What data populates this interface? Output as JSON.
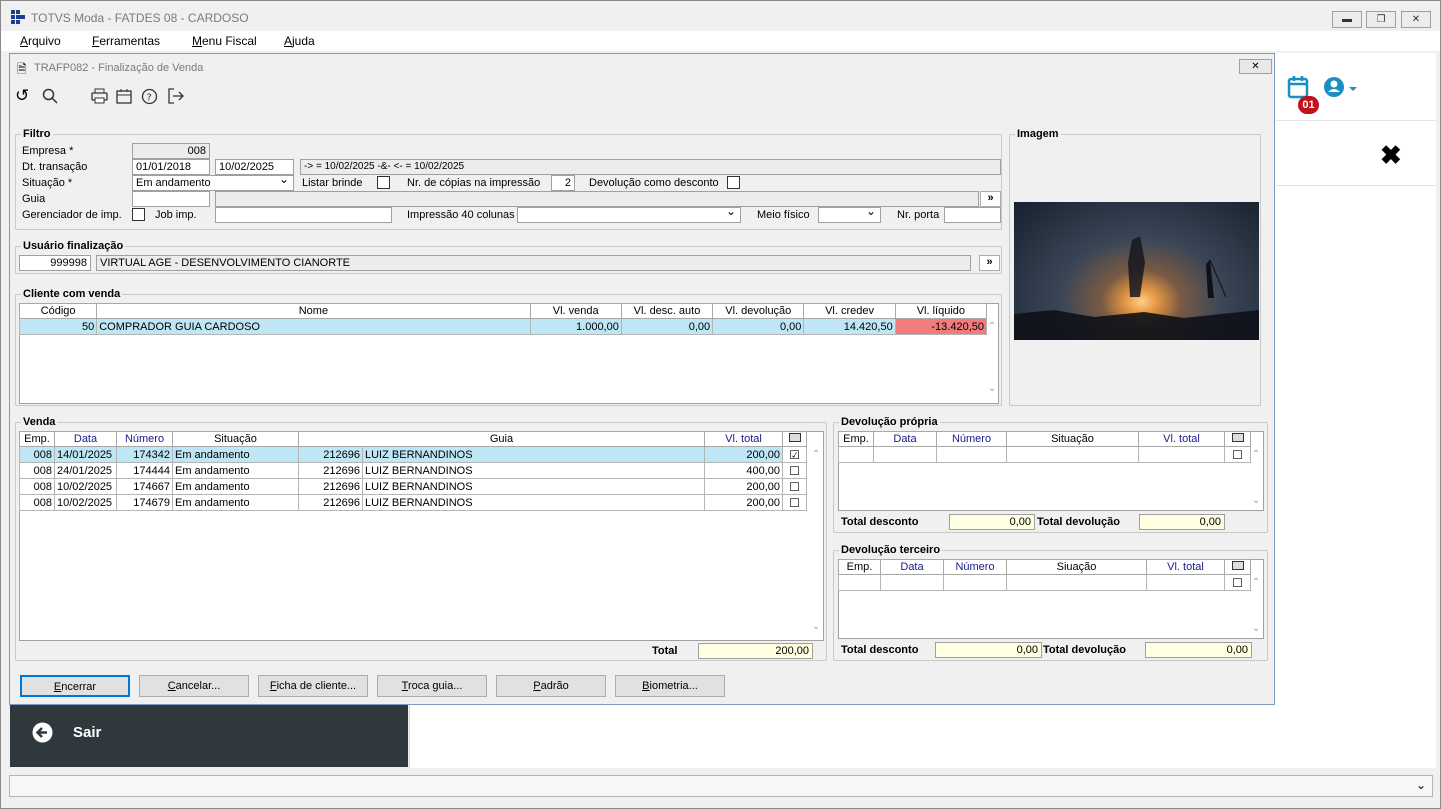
{
  "app": {
    "title": "TOTVS Moda - FATDES 08 - CARDOSO",
    "menu": [
      "Arquivo",
      "Ferramentas",
      "Menu Fiscal",
      "Ajuda"
    ]
  },
  "dialog": {
    "title": "TRAFP082 - Finalização de Venda"
  },
  "side": {
    "badge": "01",
    "sair": "Sair"
  },
  "filtro": {
    "legend": "Filtro",
    "empresa_label": "Empresa *",
    "empresa": "008",
    "dt_label": "Dt. transação",
    "dt_ini": "01/01/2018",
    "dt_fim": "10/02/2025",
    "dt_expr": "-> = 10/02/2025 -&- <- = 10/02/2025",
    "sit_label": "Situação *",
    "situacao": "Em andamento",
    "listar_brinde": "Listar brinde",
    "nr_copias_label": "Nr. de cópias na impressão",
    "nr_copias": "2",
    "devolucao_desc": "Devolução como desconto",
    "guia_label": "Guia",
    "ger_imp": "Gerenciador de imp.",
    "job_imp": "Job imp.",
    "imp40": "Impressão 40 colunas",
    "meio_fisico": "Meio físico",
    "nr_porta": "Nr. porta",
    "arrow": "»"
  },
  "imagem": {
    "legend": "Imagem"
  },
  "usuario": {
    "legend": "Usuário finalização",
    "codigo": "999998",
    "nome": "VIRTUAL AGE - DESENVOLVIMENTO CIANORTE"
  },
  "cliente": {
    "legend": "Cliente com venda",
    "headers": [
      "Código",
      "Nome",
      "Vl. venda",
      "Vl. desc. auto",
      "Vl. devolução",
      "Vl. credev",
      "Vl. líquido"
    ],
    "row": [
      "50",
      "COMPRADOR GUIA CARDOSO",
      "1.000,00",
      "0,00",
      "0,00",
      "14.420,50",
      "-13.420,50"
    ]
  },
  "venda": {
    "legend": "Venda",
    "headers": [
      "Emp.",
      "Data",
      "Número",
      "Situação",
      "Guia",
      "Vl. total"
    ],
    "rows": [
      [
        "008",
        "14/01/2025",
        "174342",
        "Em andamento",
        "212696",
        "LUIZ BERNANDINOS",
        "200,00"
      ],
      [
        "008",
        "24/01/2025",
        "174444",
        "Em andamento",
        "212696",
        "LUIZ BERNANDINOS",
        "400,00"
      ],
      [
        "008",
        "10/02/2025",
        "174667",
        "Em andamento",
        "212696",
        "LUIZ BERNANDINOS",
        "200,00"
      ],
      [
        "008",
        "10/02/2025",
        "174679",
        "Em andamento",
        "212696",
        "LUIZ BERNANDINOS",
        "200,00"
      ]
    ],
    "total_label": "Total",
    "total": "200,00"
  },
  "dev_propria": {
    "legend": "Devolução própria",
    "headers": [
      "Emp.",
      "Data",
      "Número",
      "Situação",
      "Vl. total"
    ],
    "total_desc_label": "Total desconto",
    "total_desc": "0,00",
    "total_dev_label": "Total devolução",
    "total_dev": "0,00"
  },
  "dev_terceiro": {
    "legend": "Devolução terceiro",
    "headers": [
      "Emp.",
      "Data",
      "Número",
      "Siuação",
      "Vl. total"
    ],
    "total_desc_label": "Total desconto",
    "total_desc": "0,00",
    "total_dev_label": "Total devolução",
    "total_dev": "0,00"
  },
  "buttons": [
    "Encerrar",
    "Cancelar...",
    "Ficha de cliente...",
    "Troca guia...",
    "Padrão",
    "Biometria..."
  ],
  "colors": {
    "selected_row": "#bfe6f4",
    "negative": "#f27b7b",
    "sair_bg": "#2f393d",
    "accent": "#1a8fc5"
  }
}
